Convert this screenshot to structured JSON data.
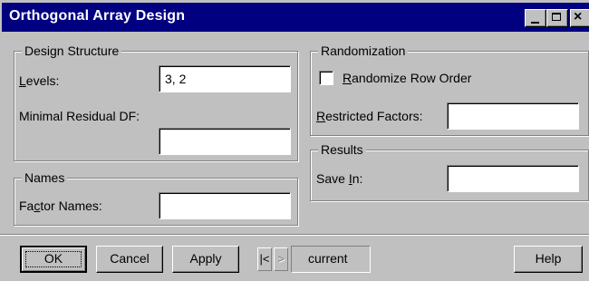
{
  "window": {
    "title": "Orthogonal Array Design",
    "controls": {
      "minimize_icon": "minimize-icon",
      "maximize_icon": "maximize-icon",
      "close_glyph": "×"
    }
  },
  "design_structure": {
    "legend": "Design Structure",
    "levels": {
      "label_pre": "",
      "label_access": "L",
      "label_post": "evels:",
      "value": "3, 2"
    },
    "minimal_residual_df": {
      "label": "Minimal Residual DF:",
      "value": ""
    }
  },
  "names": {
    "legend": "Names",
    "factor_names": {
      "label_pre": "Fa",
      "label_access": "c",
      "label_post": "tor Names:",
      "value": ""
    }
  },
  "randomization": {
    "legend": "Randomization",
    "randomize_row_order": {
      "label_pre": "",
      "label_access": "R",
      "label_post": "andomize Row Order",
      "checked": false
    },
    "restricted_factors": {
      "label_pre": "",
      "label_access": "R",
      "label_post": "estricted Factors:",
      "value": ""
    }
  },
  "results": {
    "legend": "Results",
    "save_in": {
      "label_pre": "Save ",
      "label_access": "I",
      "label_post": "n:",
      "value": ""
    }
  },
  "buttons": {
    "ok": "OK",
    "cancel": "Cancel",
    "apply": "Apply",
    "prev_glyph": "|<",
    "next_glyph": ">",
    "state": "current",
    "help": "Help"
  }
}
